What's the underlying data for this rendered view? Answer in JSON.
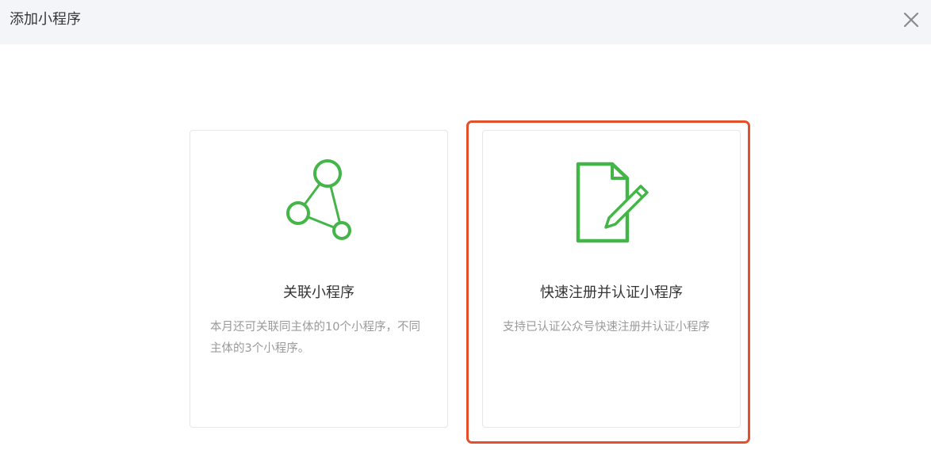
{
  "dialog": {
    "title": "添加小程序",
    "close_icon": "close-icon"
  },
  "cards": {
    "link": {
      "icon": "network-link-icon",
      "title": "关联小程序",
      "description": "本月还可关联同主体的10个小程序，不同主体的3个小程序。"
    },
    "register": {
      "icon": "document-edit-icon",
      "title": "快速注册并认证小程序",
      "description": "支持已认证公众号快速注册并认证小程序",
      "highlighted": true
    }
  },
  "colors": {
    "header_bg": "#f4f5f9",
    "icon_green": "#44b549",
    "highlight_border": "#e5502a",
    "title_text": "#353535",
    "desc_text": "#9a9a9a"
  }
}
